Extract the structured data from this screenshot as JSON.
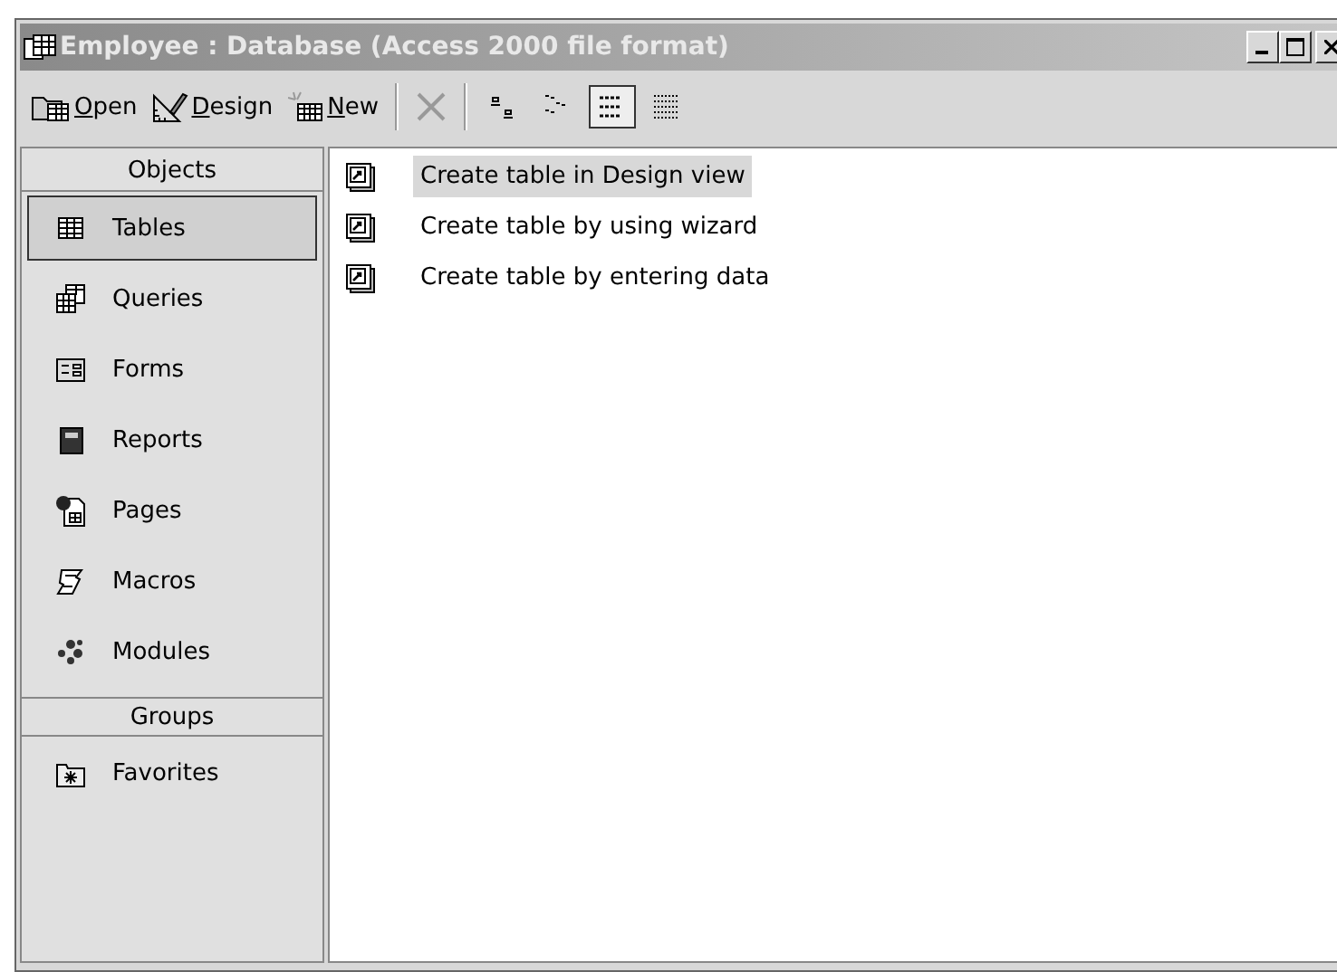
{
  "window": {
    "title": "Employee : Database (Access 2000 file format)",
    "active": false
  },
  "toolbar": {
    "commands": [
      {
        "label": "Open",
        "kind": "open"
      },
      {
        "label": "Design",
        "kind": "design"
      },
      {
        "label": "New",
        "kind": "new"
      },
      {
        "kind": "delete",
        "disabled": true
      }
    ],
    "views": [
      {
        "kind": "large",
        "selected": false
      },
      {
        "kind": "small",
        "selected": false
      },
      {
        "kind": "list",
        "selected": true
      },
      {
        "kind": "details",
        "selected": false
      }
    ]
  },
  "sidebar": {
    "sections": [
      {
        "title": "Objects",
        "items": [
          {
            "label": "Tables",
            "kind": "tables",
            "selected": true
          },
          {
            "label": "Queries",
            "kind": "queries",
            "selected": false
          },
          {
            "label": "Forms",
            "kind": "forms",
            "selected": false
          },
          {
            "label": "Reports",
            "kind": "reports",
            "selected": false
          },
          {
            "label": "Pages",
            "kind": "pages",
            "selected": false
          },
          {
            "label": "Macros",
            "kind": "macros",
            "selected": false
          },
          {
            "label": "Modules",
            "kind": "modules",
            "selected": false
          }
        ]
      },
      {
        "title": "Groups",
        "items": [
          {
            "label": "Favorites",
            "kind": "favorites",
            "selected": false
          }
        ]
      }
    ]
  },
  "list": {
    "items": [
      {
        "label": "Create table in Design view",
        "selected": true
      },
      {
        "label": "Create table by using wizard",
        "selected": false
      },
      {
        "label": "Create table by entering data",
        "selected": false
      }
    ]
  }
}
